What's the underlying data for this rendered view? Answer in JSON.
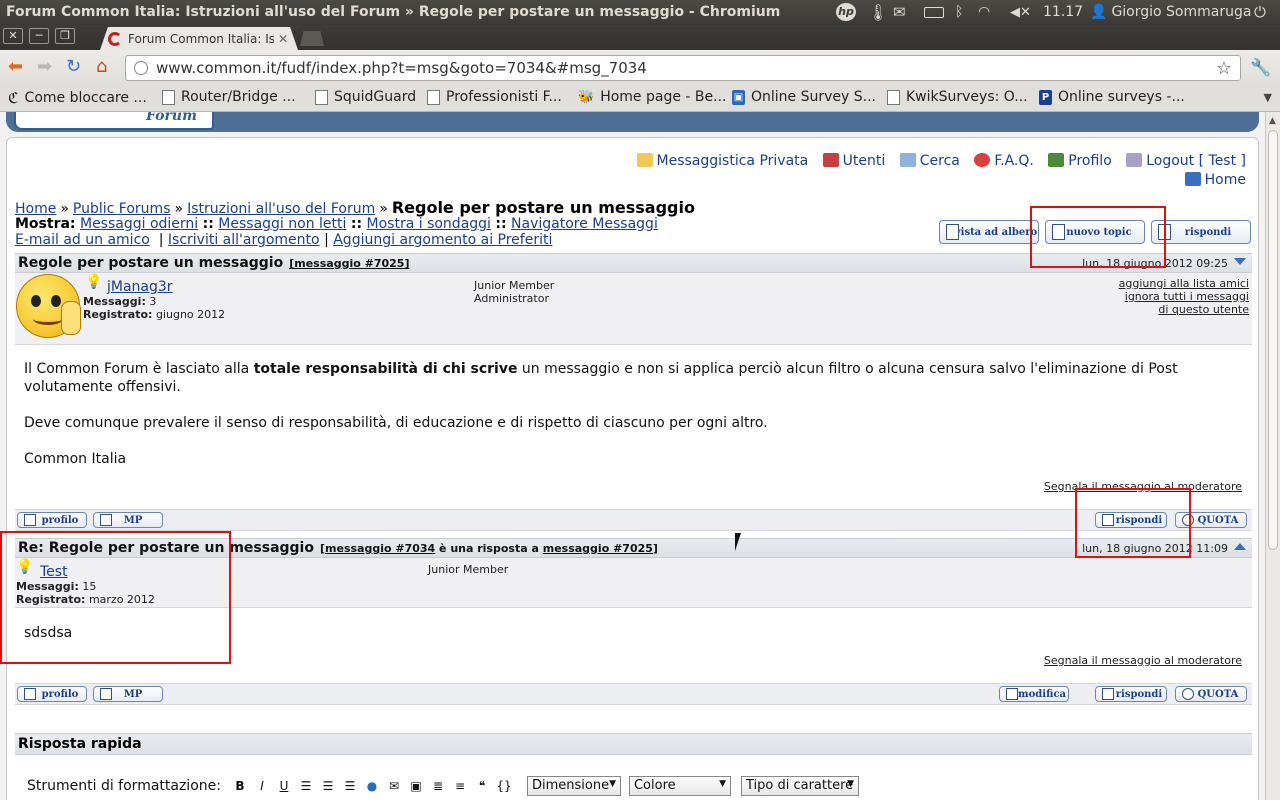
{
  "os_panel": {
    "window_title": "Forum Common Italia: Istruzioni all'uso del Forum » Regole per postare un messaggio - Chromium",
    "clock": "11.17",
    "user": "Giorgio Sommaruga",
    "icons": [
      "hp-icon",
      "battery-icon",
      "mail-icon",
      "battery-icon",
      "bluetooth-icon",
      "wifi-icon",
      "volume-mute-icon",
      "user-icon",
      "power-icon"
    ]
  },
  "browser": {
    "tab_title": "Forum Common Italia: Istruzioni all'uso del Forum",
    "url": "www.common.it/fudf/index.php?t=msg&goto=7034&#msg_7034",
    "bookmarks": [
      "Come bloccare ...",
      "Router/Bridge ...",
      "SquidGuard",
      "Professionisti F...",
      "Home page - Be...",
      "Online Survey S...",
      "KwikSurveys: O...",
      "Online surveys -..."
    ]
  },
  "forum": {
    "banner_logo_text": "Forum",
    "usermenu": {
      "privata": "Messaggistica Privata",
      "utenti": "Utenti",
      "cerca": "Cerca",
      "faq": "F.A.Q.",
      "profilo": "Profilo",
      "logout": "Logout [ Test ]",
      "home": "Home"
    },
    "breadcrumb": {
      "home": "Home",
      "sep": "»",
      "public": "Public Forums",
      "section": "Istruzioni all'uso del Forum",
      "current": "Regole per postare un messaggio"
    },
    "show": {
      "label": "Mostra:",
      "items": [
        "Messaggi odierni",
        "Messaggi non letti",
        "Mostra i sondaggi",
        "Navigatore Messaggi"
      ],
      "sep": "::"
    },
    "options": {
      "email": "E-mail ad un amico",
      "subscribe": "Iscriviti all'argomento",
      "favorites": "Aggiungi argomento ai Preferiti",
      "sep": "|"
    },
    "top_buttons": {
      "tree": "vista ad albero",
      "new_topic": "nuovo topic",
      "reply": "rispondi"
    },
    "messages": [
      {
        "title": "Regole per postare un messaggio",
        "ref": "[messaggio #7025]",
        "date": "lun, 18 giugno 2012 09:25",
        "author": "jManag3r",
        "posts_label": "Messaggi:",
        "posts": "3",
        "reg_label": "Registrato:",
        "registered": "giugno 2012",
        "rank1": "Junior Member",
        "rank2": "Administrator",
        "links": [
          "aggiungi alla lista amici",
          "ignora tutti i messaggi",
          "di questo utente"
        ],
        "body_pre": "Il Common Forum è lasciato alla ",
        "body_bold": "totale responsabilità di chi scrive",
        "body_post": " un messaggio e non si applica perciò alcun filtro o alcuna censura salvo l'eliminazione di Post volutamente offensivi.",
        "body2": "Deve comunque prevalere il senso di responsabilità, di educazione e di rispetto di ciascuno per ogni altro.",
        "body3": "Common Italia",
        "report": "Segnala il messaggio al moderatore",
        "btn_profile": "profilo",
        "btn_pm": "MP",
        "btn_reply": "rispondi",
        "btn_quote": "QUOTA"
      },
      {
        "title": "Re: Regole per postare un messaggio",
        "ref_open": "[",
        "ref_a": "messaggio #7034",
        "ref_mid": " è una risposta a ",
        "ref_b": "messaggio #7025",
        "ref_close": "]",
        "date": "lun, 18 giugno 2012 11:09",
        "author": "Test",
        "posts_label": "Messaggi:",
        "posts": "15",
        "reg_label": "Registrato:",
        "registered": "marzo 2012",
        "rank1": "Junior Member",
        "body": "sdsdsa",
        "report": "Segnala il messaggio al moderatore",
        "btn_profile": "profilo",
        "btn_pm": "MP",
        "btn_edit": "modifica",
        "btn_reply": "rispondi",
        "btn_quote": "QUOTA"
      }
    ],
    "quick_reply": {
      "title": "Risposta rapida",
      "tools_label": "Strumenti di formattazione:",
      "tools": [
        "B",
        "I",
        "U"
      ],
      "size": "Dimensione",
      "color": "Colore",
      "font": "Tipo di carattere"
    }
  },
  "colors": {
    "link": "#1a3f8f",
    "annotation": "#e01010",
    "header_bg": "#dcdfe4",
    "banner": "#4f6f96"
  }
}
